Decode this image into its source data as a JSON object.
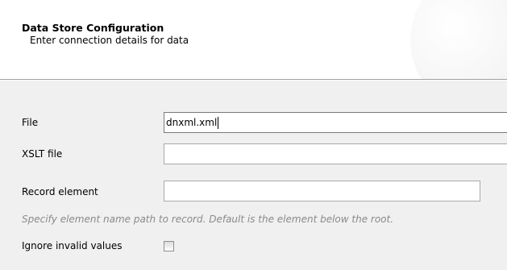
{
  "header": {
    "title": "Data Store Configuration",
    "subtitle": "Enter connection details for data"
  },
  "form": {
    "file": {
      "label": "File",
      "value": "dnxml.xml"
    },
    "xslt_file": {
      "label": "XSLT file",
      "value": ""
    },
    "record_element": {
      "label": "Record element",
      "value": ""
    },
    "hint": "Specify element name path to record.  Default is the element below the root.",
    "ignore_invalid": {
      "label": "Ignore invalid values",
      "checked": false
    }
  }
}
